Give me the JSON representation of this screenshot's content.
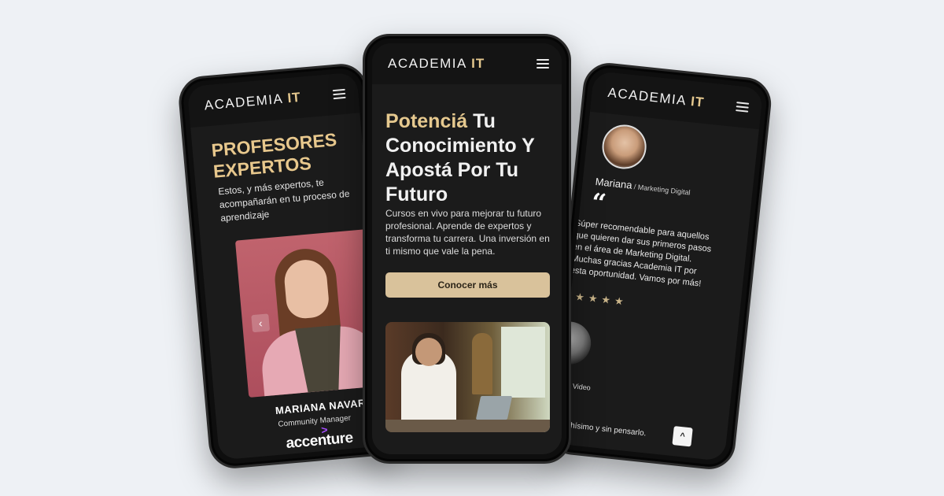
{
  "brand": {
    "name": "ACADEMIA",
    "highlight": "IT"
  },
  "left_phone": {
    "title": "PROFESORES EXPERTOS",
    "description": "Estos, y más expertos, te acompañarán en tu proceso de aprendizaje",
    "carousel_prev": "‹",
    "teacher": {
      "name": "MARIANA NAVARRO",
      "role": "Community Manager",
      "company": "accenture",
      "company_mark": ">"
    }
  },
  "center_phone": {
    "hero_accent": "Potenciá",
    "hero_rest": " Tu Conocimiento Y Apostá Por Tu Futuro",
    "hero_desc": "Cursos en vivo para mejorar tu futuro profesional. Aprende de expertos y transforma tu carrera. Una inversión en ti mismo que vale la pena.",
    "cta_label": "Conocer más"
  },
  "right_phone": {
    "reviewer": {
      "name": "Mariana",
      "role": " / Marketing Digital"
    },
    "quote_mark": "“",
    "review": "Súper recomendable para aquellos que quieren dar sus primeros pasos en el área de Marketing Digital. Muchas gracias Academia IT por esta oportunidad. Vamos por más!",
    "stars": "★★★★",
    "second_reviewer_role": "OS / Video",
    "snippet": "muchísimo y sin pensarlo.",
    "scroll_top": "^"
  },
  "colors": {
    "accent": "#e6c98f",
    "background": "#eef1f5",
    "screen": "#1b1b1b",
    "cta": "#d9c29b"
  }
}
